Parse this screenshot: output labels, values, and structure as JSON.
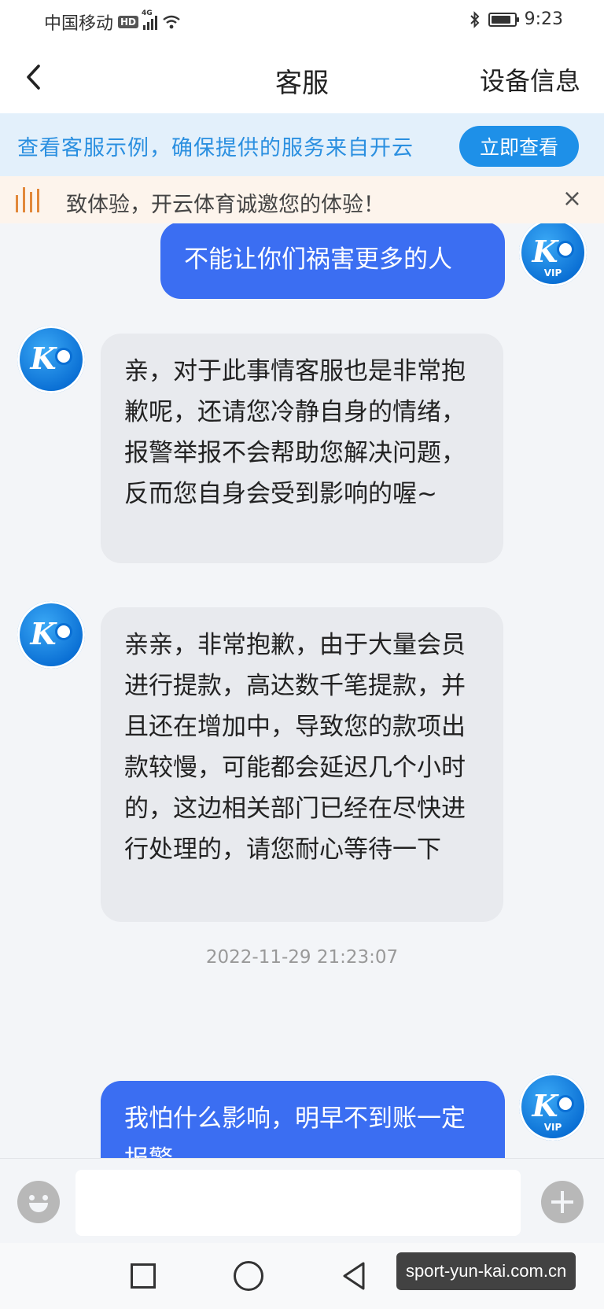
{
  "status_bar": {
    "carrier": "中国移动",
    "hd": "HD",
    "network": "4G",
    "time": "9:23"
  },
  "header": {
    "back_icon": "chevron-left-icon",
    "title": "客服",
    "device_info": "设备信息"
  },
  "promo": {
    "text": "查看客服示例，确保提供的服务来自开云",
    "button": "立即查看"
  },
  "marquee": {
    "text": "致体验，开云体育诚邀您的体验！",
    "close": "×"
  },
  "messages": [
    {
      "sender": "user",
      "text": "不能让你们祸害更多的人"
    },
    {
      "sender": "agent",
      "text": "亲，对于此事情客服也是非常抱歉呢，还请您冷静自身的情绪，报警举报不会帮助您解决问题，反而您自身会受到影响的喔~"
    },
    {
      "sender": "agent",
      "text": "亲亲，非常抱歉，由于大量会员进行提款，高达数千笔提款，并且还在增加中，导致您的款项出款较慢，可能都会延迟几个小时的，这边相关部门已经在尽快进行处理的，请您耐心等待一下"
    },
    {
      "timestamp": "2022-11-29 21:23:07"
    },
    {
      "sender": "user",
      "text": "我怕什么影响，明早不到账一定报警"
    }
  ],
  "avatar": {
    "logo_text": "K",
    "vip_label": "VIP"
  },
  "input": {
    "value": "",
    "placeholder": ""
  },
  "watermark": "sport-yun-kai.com.cn",
  "colors": {
    "user_bubble": "#3b6ef2",
    "agent_bubble": "#e8eaee",
    "accent": "#1e90e8",
    "chat_bg": "#f3f5f8"
  }
}
